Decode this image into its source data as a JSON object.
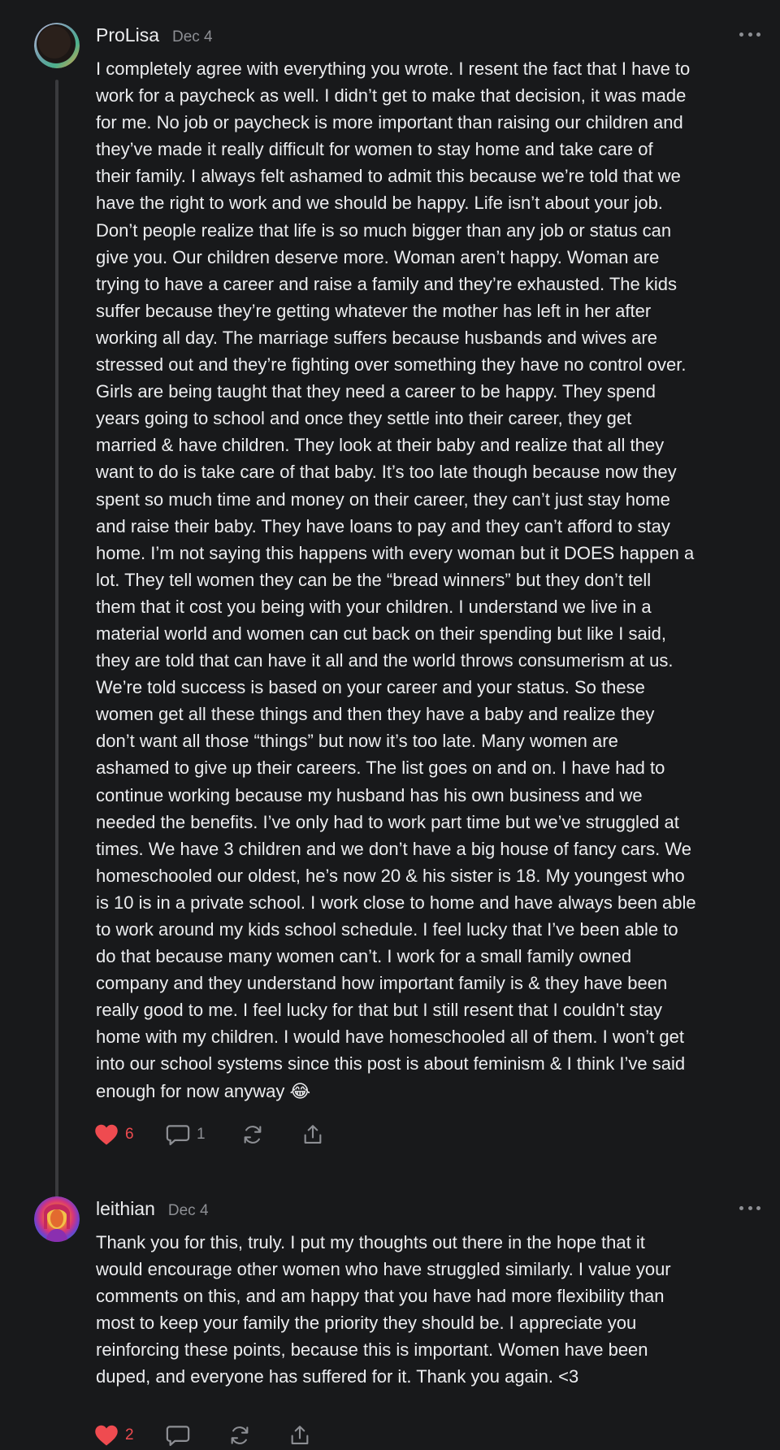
{
  "comments": [
    {
      "username": "ProLisa",
      "date": "Dec 4",
      "avatar_icon": "avatar-dark-ring",
      "body_lines": [
        "I completely agree with everything you wrote. I resent the fact that I have to",
        "work for a paycheck as well. I didn’t get to make that decision, it was made",
        "for me. No job or paycheck is more important than raising our children and",
        "they’ve made it really difficult for women to stay home and take care of",
        "their family. I always felt ashamed to admit this because we’re told that we",
        "have the right to work and we should be happy. Life isn’t about your job.",
        "Don’t people realize that life is so much bigger than any job or status can",
        "give you. Our children deserve more. Woman aren’t happy. Woman are",
        "trying to have a career and raise a family and they’re exhausted. The kids",
        "suffer because they’re getting whatever the mother has left in her after",
        "working all day. The marriage suffers because husbands and wives are",
        "stressed out and they’re fighting over something they have no control over.",
        "Girls are being taught that they need a career to be happy. They spend",
        "years going to school and once they settle into their career, they get",
        "married & have children. They look at their baby and realize that all they",
        "want to do is take care of that baby. It’s too late though because now they",
        "spent so much time and money on their career, they can’t just stay home",
        "and raise their baby. They have loans to pay and they can’t afford to stay",
        "home. I’m not saying this happens with every woman but it DOES happen a",
        "lot. They tell women they can be the “bread winners” but they don’t tell",
        "them that it cost you being with your children. I understand we live in a",
        "material world and women can cut back on their spending but like I said,",
        "they are told that can have it all and the world throws consumerism at us.",
        "We’re told success is based on your career and your status. So these",
        "women get all these things and then they have a baby and realize they",
        "don’t want all those “things” but now it’s too late. Many women are",
        "ashamed to give up their careers. The list goes on and on. I have had to",
        "continue working because my husband has his own business and we",
        "needed the benefits. I’ve only had to work part time but we’ve struggled at",
        "times. We have 3 children and we don’t have a big house of fancy cars. We",
        "homeschooled our oldest, he’s now 20 & his sister is 18. My youngest who",
        "is 10 is in a private school. I work close to home and have always been able",
        "to work around my kids school schedule. I feel lucky that I’ve been able to",
        "do that because many women can’t. I work for a small family owned",
        "company and they understand how important family is & they have been",
        "really good to me. I feel lucky for that but I still resent that I couldn’t stay",
        "home with my children. I would have homeschooled all of them. I won’t get",
        "into our school systems since this post is about feminism & I think I’ve said",
        "enough for now anyway 😂"
      ],
      "likes": "6",
      "replies": "1"
    },
    {
      "username": "leithian",
      "date": "Dec 4",
      "avatar_icon": "avatar-rainbow-portrait",
      "body_lines": [
        "Thank you for this, truly. I put my thoughts out there in the hope that it",
        "would encourage other women who have struggled similarly. I value your",
        "comments on this, and am happy that you have had more flexibility than",
        "most to keep your family the priority they should be. I appreciate you",
        "reinforcing these points, because this is important. Women have been",
        "duped, and everyone has suffered for it. Thank you again. <3"
      ],
      "likes": "2",
      "replies": ""
    }
  ],
  "colors": {
    "background": "#18191b",
    "text": "#ecedef",
    "muted": "#8d8f94",
    "like": "#ef4b50",
    "thread_line": "#3a3b3e"
  },
  "icons": {
    "more": "more-horizontal-icon",
    "like": "heart-icon",
    "reply": "comment-bubble-icon",
    "restack": "restack-icon",
    "share": "share-icon"
  }
}
